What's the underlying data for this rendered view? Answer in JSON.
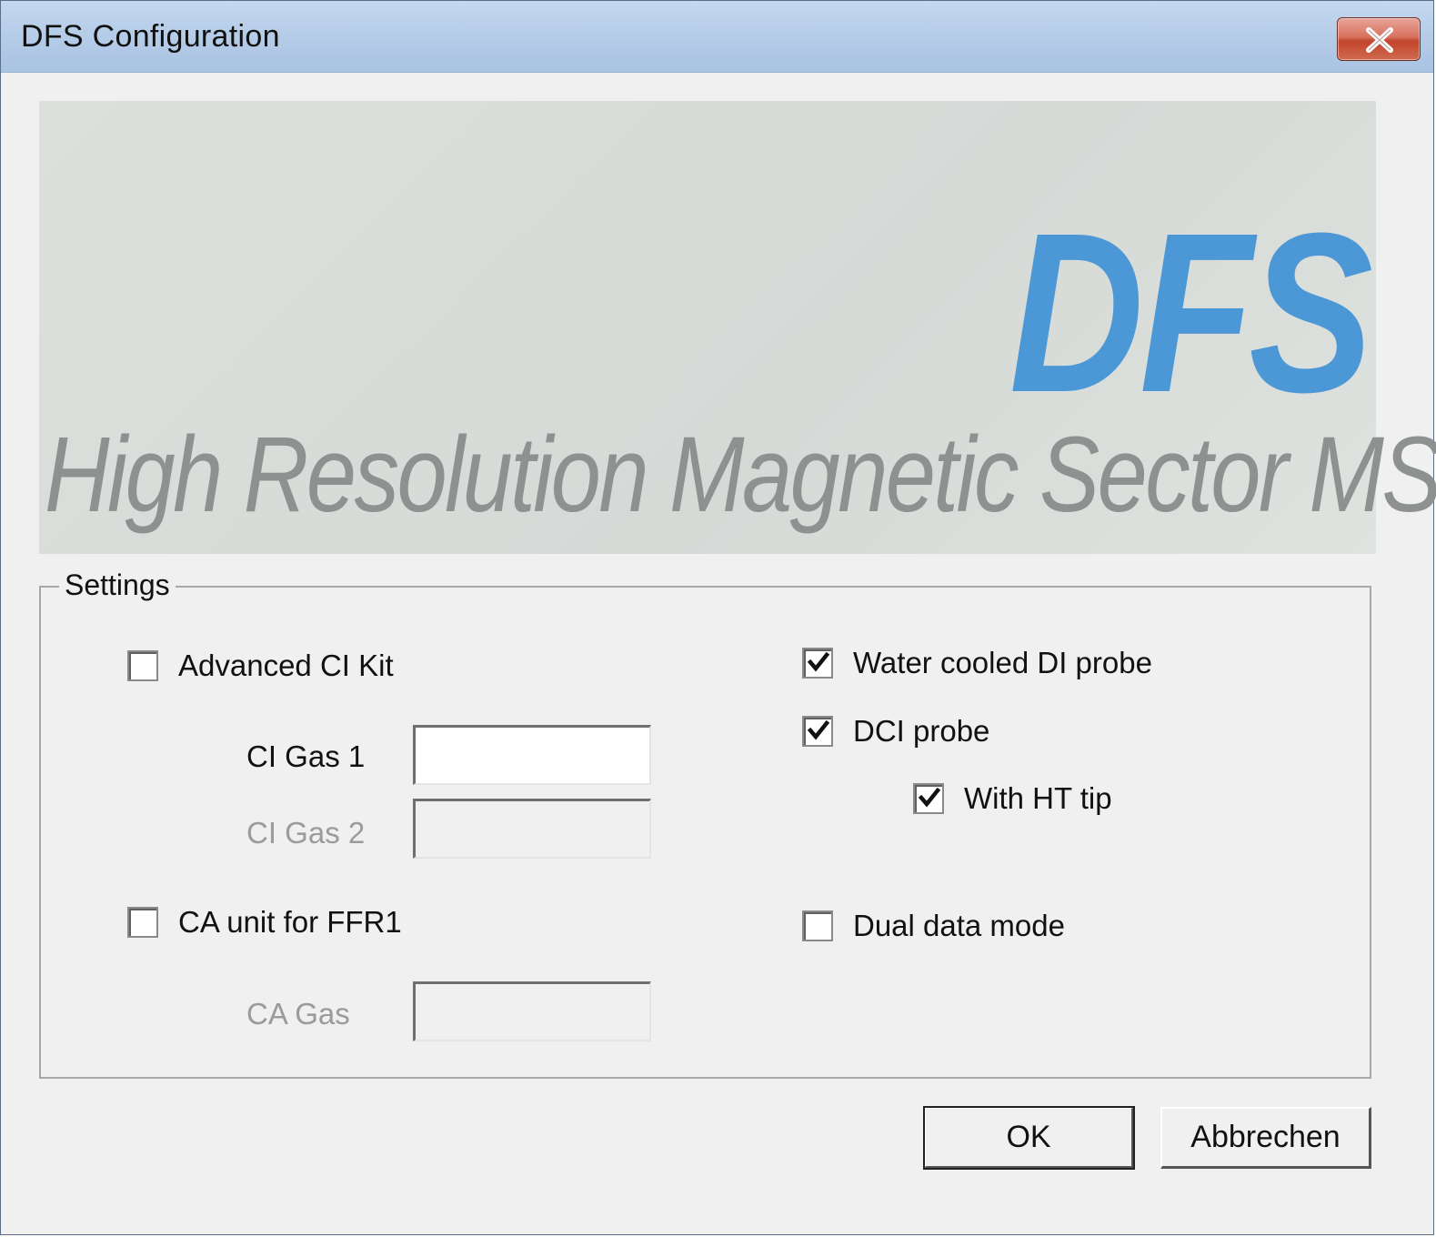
{
  "window": {
    "title": "DFS Configuration",
    "close_label": "close"
  },
  "banner": {
    "logo_text": "DFS",
    "tagline": "High Resolution Magnetic Sector MS",
    "logo_color": "#4c98d6",
    "tagline_color": "#8d9290"
  },
  "settings": {
    "group_title": "Settings",
    "advanced_ci_kit": {
      "label": "Advanced CI Kit",
      "checked": false
    },
    "ci_gas_1": {
      "label": "CI Gas 1",
      "value": "",
      "enabled": true
    },
    "ci_gas_2": {
      "label": "CI Gas 2",
      "value": "",
      "enabled": false
    },
    "ca_unit_ffr1": {
      "label": "CA unit for FFR1",
      "checked": false
    },
    "ca_gas": {
      "label": "CA Gas",
      "value": "",
      "enabled": false
    },
    "water_cooled_di_probe": {
      "label": "Water cooled DI probe",
      "checked": true
    },
    "dci_probe": {
      "label": "DCI probe",
      "checked": true
    },
    "with_ht_tip": {
      "label": "With HT tip",
      "checked": true
    },
    "dual_data_mode": {
      "label": "Dual data mode",
      "checked": false
    }
  },
  "buttons": {
    "ok_label": "OK",
    "cancel_label": "Abbrechen"
  }
}
